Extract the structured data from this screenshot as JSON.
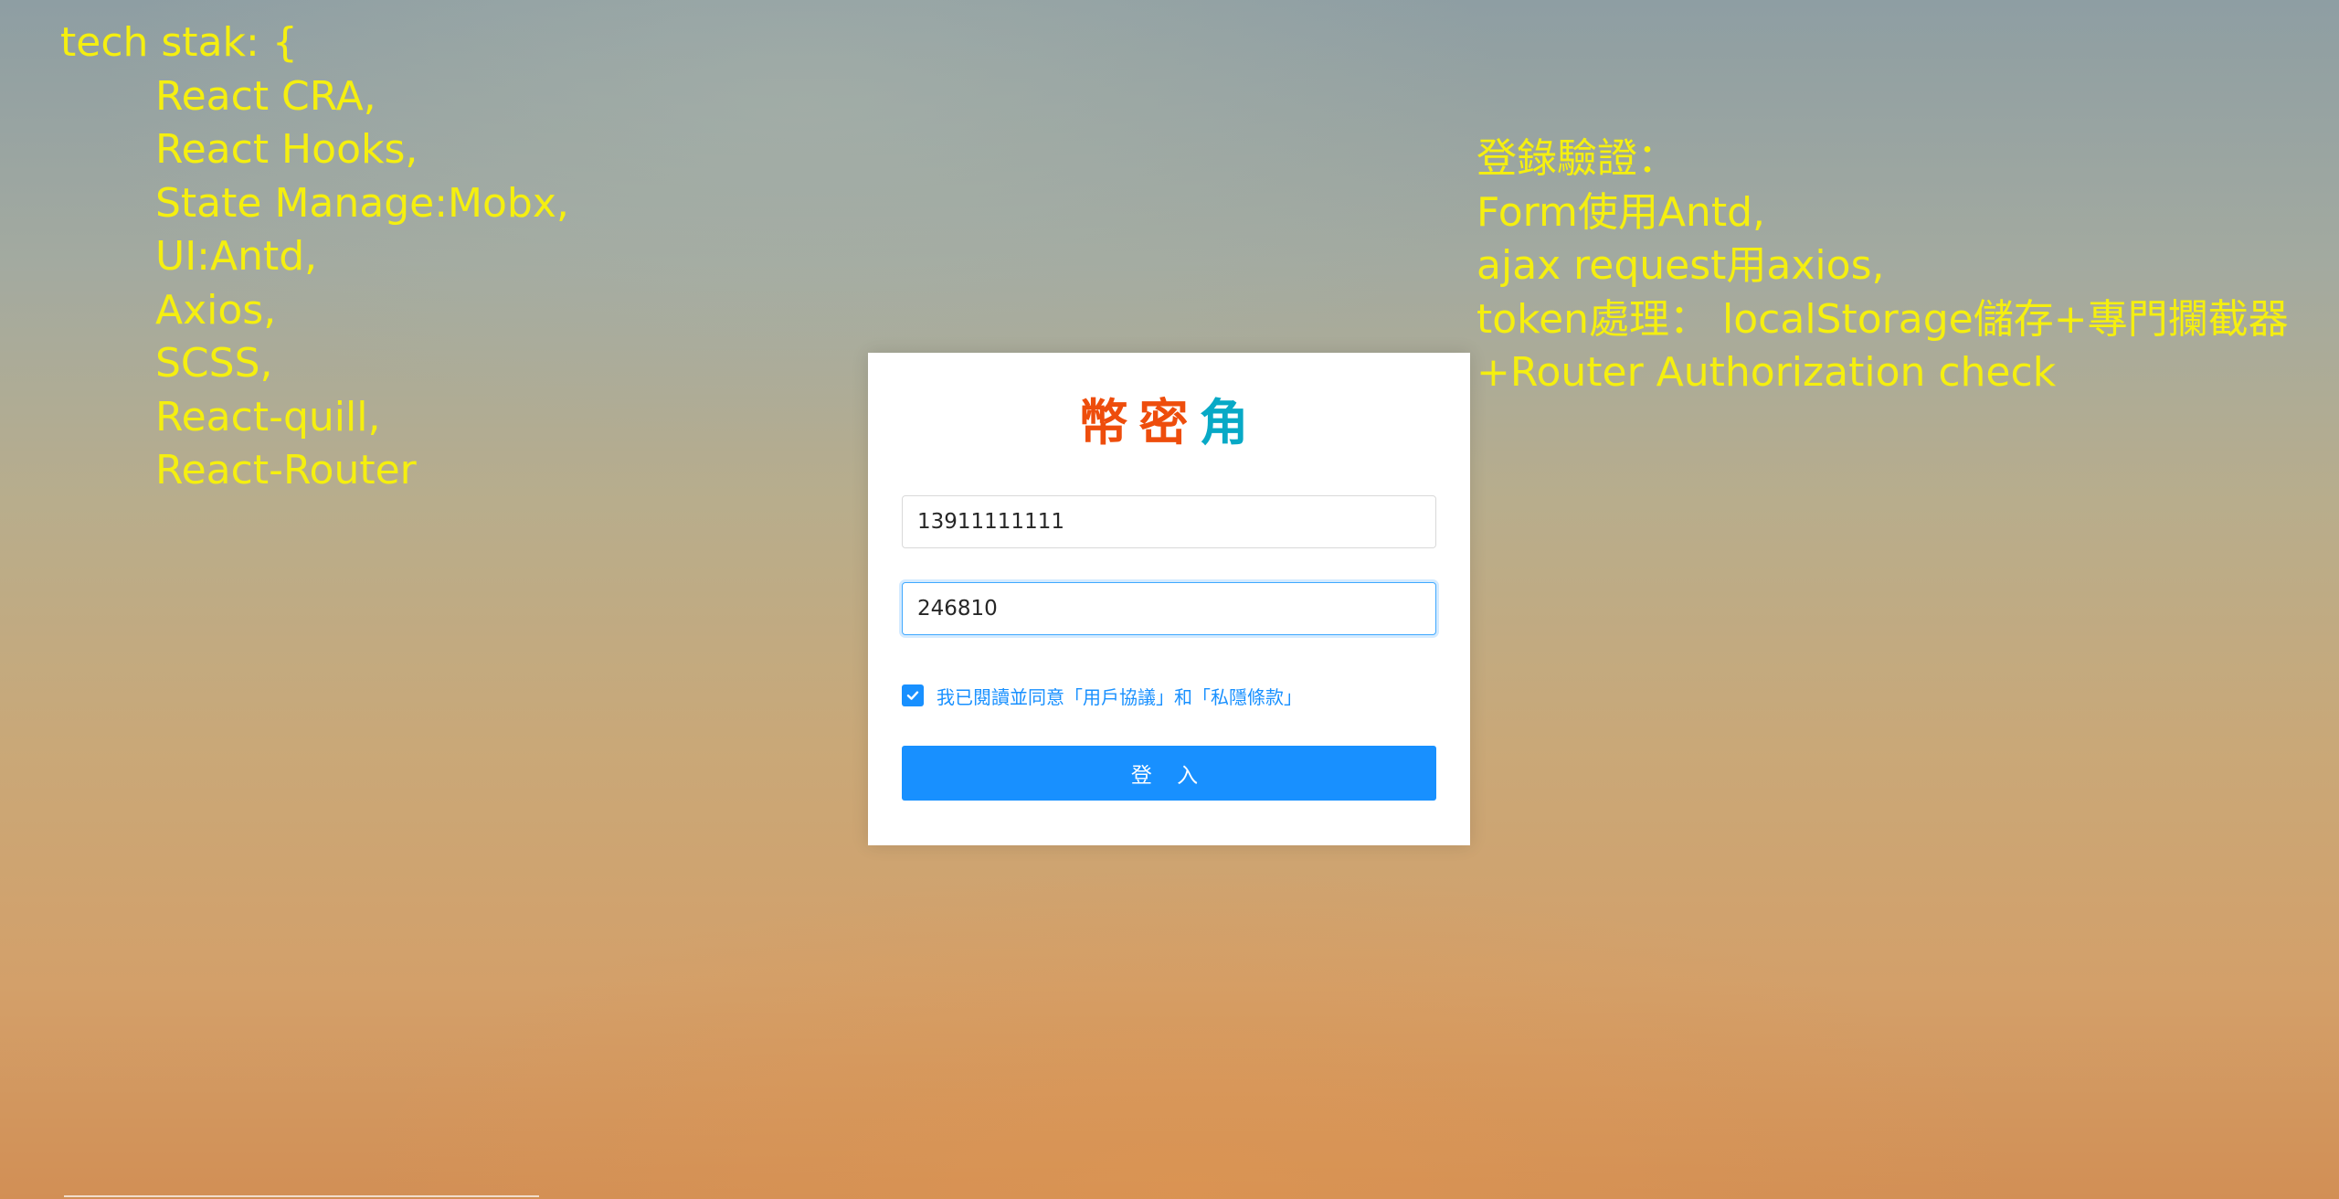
{
  "notes": {
    "left": [
      "tech stak: {",
      "React CRA,",
      "React Hooks,",
      "State Manage:Mobx,",
      "UI:Antd,",
      "Axios,",
      "SCSS,",
      "React-quill,",
      "React-Router"
    ],
    "right": [
      "登錄驗證：",
      "Form使用Antd,",
      "ajax request用axios,",
      "token處理： localStorage儲存+專門攔截器",
      "+Router Authorization check"
    ]
  },
  "login": {
    "brand": [
      "幣",
      "密",
      "角"
    ],
    "phone_value": "13911111111",
    "code_value": "246810",
    "agreement_checked": true,
    "agreement_text": "我已閱讀並同意「用戶協議」和「私隱條款」",
    "submit_label": "登 入"
  },
  "colors": {
    "note_text": "#f5ef10",
    "brand_orange": "#ee4d0c",
    "brand_cyan": "#07a9c6",
    "primary": "#1890ff"
  }
}
